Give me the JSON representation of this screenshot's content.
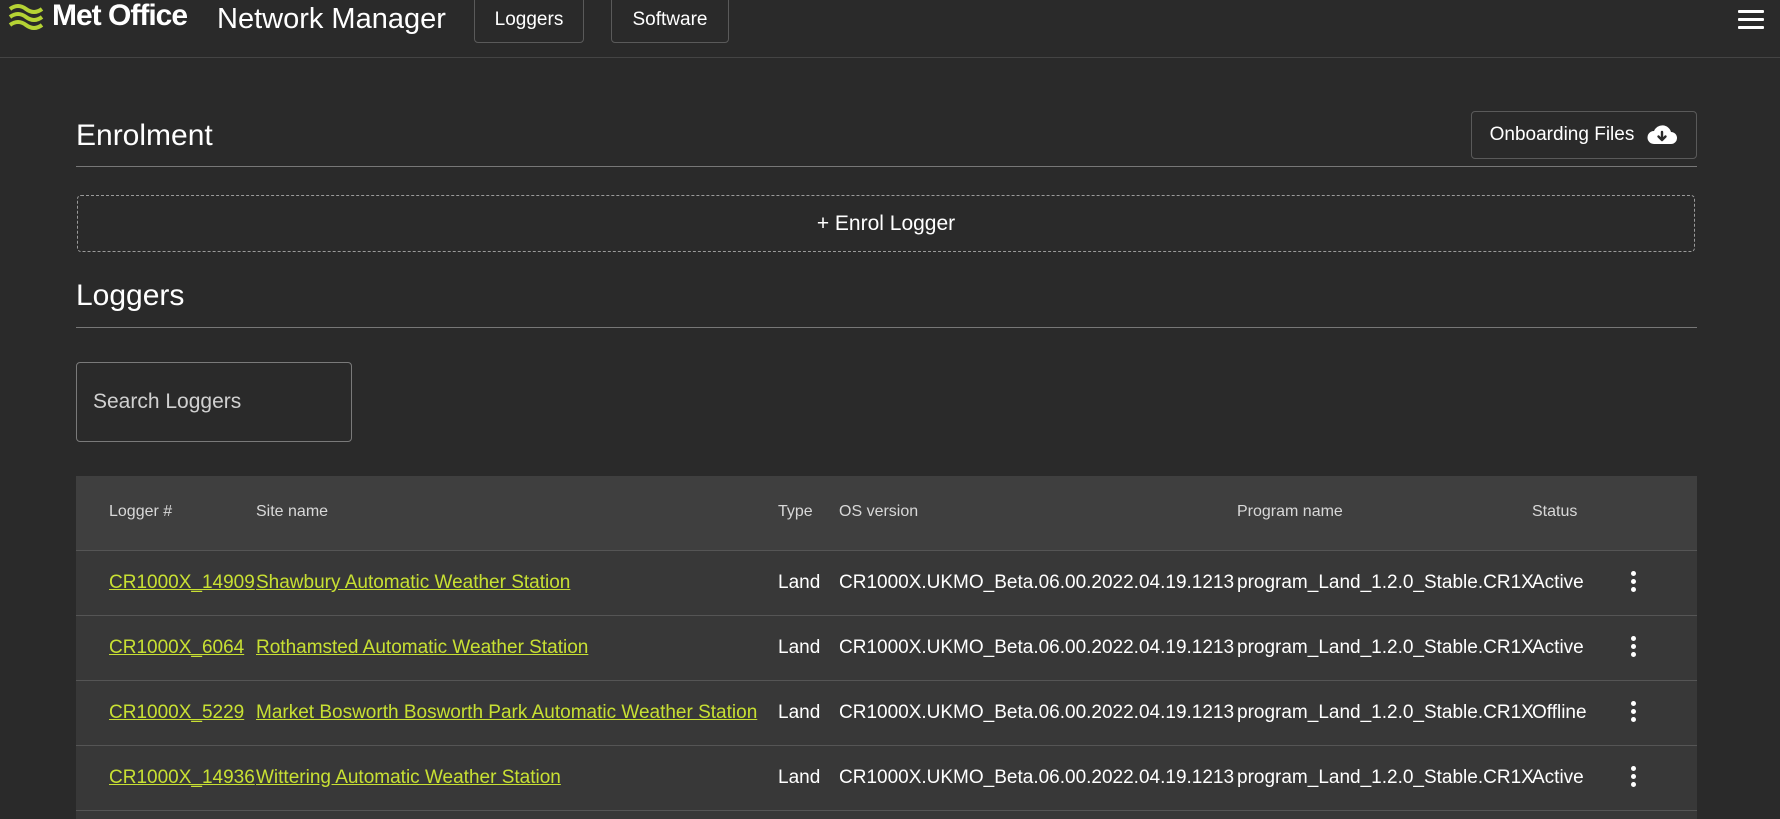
{
  "header": {
    "logo_text": "Met Office",
    "app_title": "Network Manager",
    "nav": [
      {
        "label": "Loggers"
      },
      {
        "label": "Software"
      }
    ],
    "menu_icon": "hamburger-menu-icon"
  },
  "enrolment": {
    "title": "Enrolment",
    "onboarding_button": "Onboarding Files",
    "onboarding_icon": "cloud-download-icon",
    "enrol_button": "+ Enrol Logger"
  },
  "loggers": {
    "title": "Loggers",
    "search_placeholder": "Search Loggers",
    "columns": [
      "Logger #",
      "Site name",
      "Type",
      "OS version",
      "Program name",
      "Status"
    ],
    "rows": [
      {
        "logger": "CR1000X_14909",
        "site": "Shawbury Automatic Weather Station",
        "type": "Land",
        "os": "CR1000X.UKMO_Beta.06.00.2022.04.19.1213",
        "program": "program_Land_1.2.0_Stable.CR1X",
        "status": "Active"
      },
      {
        "logger": "CR1000X_6064",
        "site": "Rothamsted Automatic Weather Station",
        "type": "Land",
        "os": "CR1000X.UKMO_Beta.06.00.2022.04.19.1213",
        "program": "program_Land_1.2.0_Stable.CR1X",
        "status": "Active"
      },
      {
        "logger": "CR1000X_5229",
        "site": "Market Bosworth Bosworth Park Automatic Weather Station",
        "type": "Land",
        "os": "CR1000X.UKMO_Beta.06.00.2022.04.19.1213",
        "program": "program_Land_1.2.0_Stable.CR1X",
        "status": "Offline"
      },
      {
        "logger": "CR1000X_14936",
        "site": "Wittering Automatic Weather Station",
        "type": "Land",
        "os": "CR1000X.UKMO_Beta.06.00.2022.04.19.1213",
        "program": "program_Land_1.2.0_Stable.CR1X",
        "status": "Active"
      }
    ]
  },
  "colors": {
    "background": "#2a2a2a",
    "link": "#c8e033",
    "logo_accent": "#b5d334"
  }
}
